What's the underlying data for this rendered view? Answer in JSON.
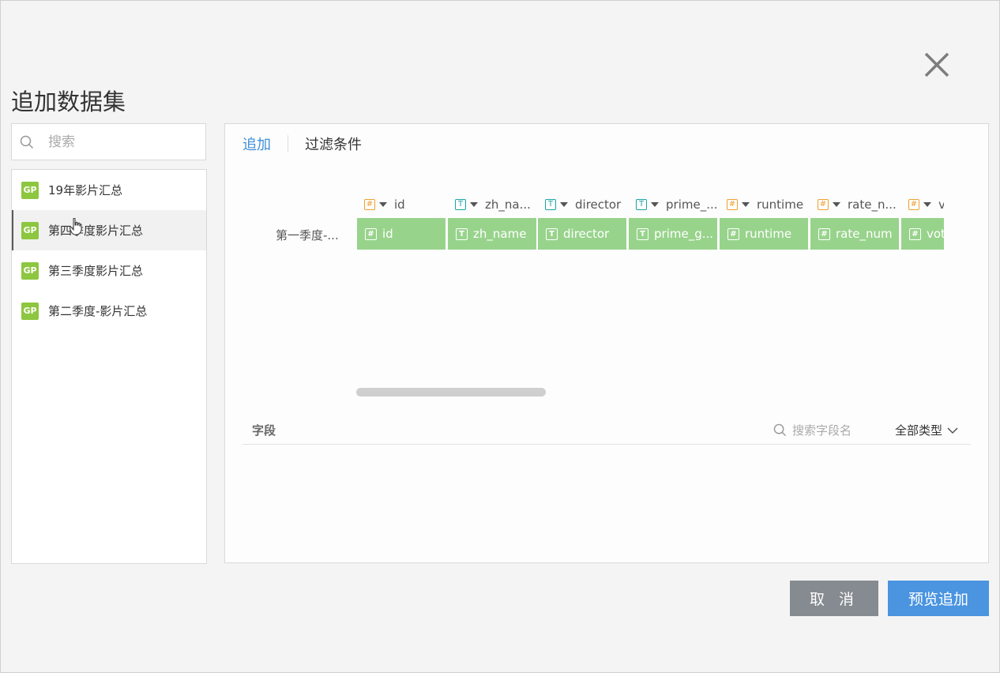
{
  "dialog": {
    "title": "追加数据集",
    "close_icon": "close-icon"
  },
  "sidebar": {
    "search_placeholder": "搜索",
    "items": [
      {
        "badge": "GP",
        "label": "19年影片汇总"
      },
      {
        "badge": "GP",
        "label": "第四季度影片汇总",
        "active": true
      },
      {
        "badge": "GP",
        "label": "第三季度影片汇总"
      },
      {
        "badge": "GP",
        "label": "第二季度-影片汇总"
      }
    ]
  },
  "panel": {
    "tabs": [
      "追加",
      "过滤条件"
    ],
    "active_tab": "追加",
    "row_label": "第一季度-...",
    "columns": [
      {
        "type": "num",
        "type_symbol": "#",
        "header": "id",
        "cell": "id"
      },
      {
        "type": "text",
        "type_symbol": "T",
        "header": "zh_na...",
        "cell": "zh_name"
      },
      {
        "type": "text",
        "type_symbol": "T",
        "header": "director",
        "cell": "director"
      },
      {
        "type": "text",
        "type_symbol": "T",
        "header": "prime_...",
        "cell": "prime_g..."
      },
      {
        "type": "num",
        "type_symbol": "#",
        "header": "runtime",
        "cell": "runtime"
      },
      {
        "type": "num",
        "type_symbol": "#",
        "header": "rate_n...",
        "cell": "rate_num"
      },
      {
        "type": "num",
        "type_symbol": "#",
        "header": "v",
        "cell": "vot"
      }
    ],
    "fields": {
      "title": "字段",
      "search_placeholder": "搜索字段名",
      "type_filter": "全部类型"
    }
  },
  "buttons": {
    "cancel": "取 消",
    "confirm": "预览追加"
  },
  "colors": {
    "accent": "#3d8fd8",
    "cell_green": "#98d38c",
    "badge_green": "#8dc63f",
    "number_type": "#f0a030",
    "text_type": "#1aa4a4",
    "cancel_bg": "#868b91",
    "confirm_bg": "#4a94e0"
  }
}
